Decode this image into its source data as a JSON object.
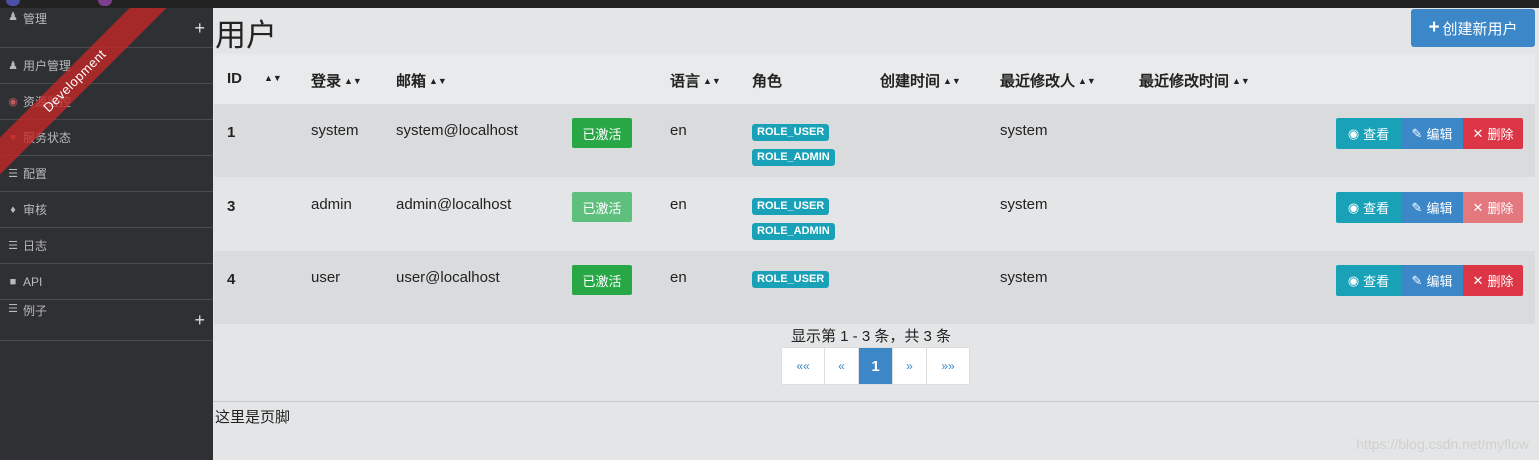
{
  "colors": {
    "primary": "#3c87c8",
    "info": "#19a1b8",
    "success": "#27a745",
    "danger": "#dc3545"
  },
  "ribbon": "Development",
  "sidebar": {
    "items": [
      {
        "label": "管理",
        "icon": "user-plus-icon"
      },
      {
        "label": "用户管理",
        "icon": "user-icon"
      },
      {
        "label": "资源监控",
        "icon": "dashboard-icon"
      },
      {
        "label": "服务状态",
        "icon": "heart-icon"
      },
      {
        "label": "配置",
        "icon": "list-icon"
      },
      {
        "label": "审核",
        "icon": "bell-icon"
      },
      {
        "label": "日志",
        "icon": "tasks-icon"
      },
      {
        "label": "API",
        "icon": "book-icon"
      },
      {
        "label": "例子",
        "icon": "tasks-icon"
      }
    ]
  },
  "page": {
    "title": "用户",
    "create_button": "创建新用户"
  },
  "table": {
    "headers": [
      "ID",
      "登录",
      "邮箱",
      "语言",
      "角色",
      "创建时间",
      "最近修改人",
      "最近修改时间"
    ],
    "rows": [
      {
        "id": "1",
        "login": "system",
        "email": "system@localhost",
        "status": "已激活",
        "lang": "en",
        "roles": [
          "ROLE_USER",
          "ROLE_ADMIN"
        ],
        "modified_by": "system"
      },
      {
        "id": "3",
        "login": "admin",
        "email": "admin@localhost",
        "status": "已激活",
        "lang": "en",
        "roles": [
          "ROLE_USER",
          "ROLE_ADMIN"
        ],
        "modified_by": "system"
      },
      {
        "id": "4",
        "login": "user",
        "email": "user@localhost",
        "status": "已激活",
        "lang": "en",
        "roles": [
          "ROLE_USER"
        ],
        "modified_by": "system"
      }
    ],
    "actions": {
      "view": "查看",
      "edit": "编辑",
      "delete": "删除"
    }
  },
  "pagination": {
    "summary": "显示第 1 - 3 条，共 3 条",
    "first": "««",
    "prev": "«",
    "current": "1",
    "next": "»",
    "last": "»»"
  },
  "footer": {
    "text": "这里是页脚"
  },
  "watermark": "https://blog.csdn.net/myflow"
}
